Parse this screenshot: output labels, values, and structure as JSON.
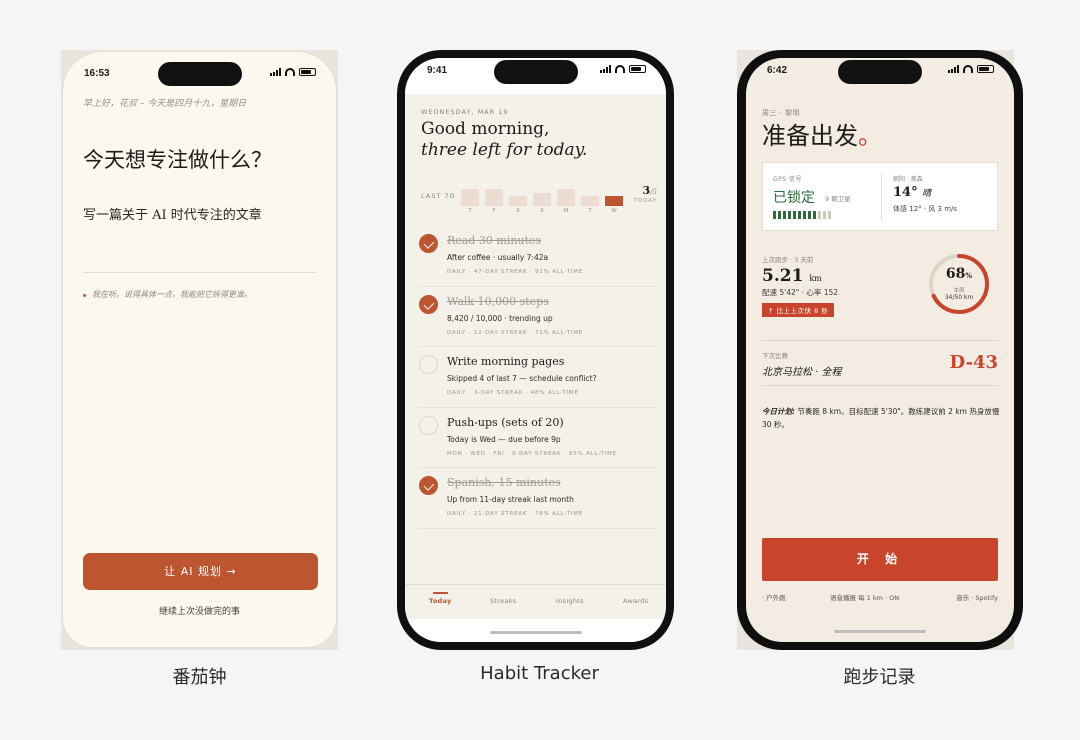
{
  "captions": [
    "番茄钟",
    "Habit Tracker",
    "跑步记录"
  ],
  "pomodoro": {
    "time": "16:53",
    "greeting": "早上好，花叔 – 今天是四月十九，星期日",
    "question": "今天想专注做什么？",
    "answer": "写一篇关于 AI 时代专注的文章",
    "hint": "我在听。说得具体一点，我能把它拆得更准。",
    "cta": "让 AI 规划 →",
    "secondary": "继续上次没做完的事",
    "accent": "#be5531"
  },
  "habits": {
    "time": "9:41",
    "date": "WEDNESDAY, MAR 19",
    "greeting": "Good morning,",
    "greeting2": "three left for today.",
    "week_label": "LAST 7D",
    "week": [
      {
        "day": "T",
        "level": 0.85
      },
      {
        "day": "F",
        "level": 0.85
      },
      {
        "day": "S",
        "level": 0.5
      },
      {
        "day": "S",
        "level": 0.65
      },
      {
        "day": "M",
        "level": 0.85
      },
      {
        "day": "T",
        "level": 0.5
      },
      {
        "day": "W",
        "level": 0.5,
        "current": true
      }
    ],
    "count": "3",
    "count_total": "/5",
    "today": "TODAY",
    "items": [
      {
        "name": "Read 30 minutes",
        "detail": "After coffee · usually 7:42a",
        "meta": "DAILY · 47-DAY STREAK · 92% ALL-TIME",
        "done": true
      },
      {
        "name": "Walk 10,000 steps",
        "detail": "8,420 / 10,000 · trending up",
        "meta": "DAILY · 12-DAY STREAK · 71% ALL-TIME",
        "done": true
      },
      {
        "name": "Write morning pages",
        "detail": "Skipped 4 of last 7 — schedule conflict?",
        "meta": "DAILY · 3-DAY STREAK · 48% ALL-TIME",
        "done": false
      },
      {
        "name": "Push-ups (sets of 20)",
        "detail": "Today is Wed — due before 9p",
        "meta": "MON · WED · FRI · 8-DAY STREAK · 85% ALL-TIME",
        "done": false
      },
      {
        "name": "Spanish, 15 minutes",
        "detail": "Up from 11-day streak last month",
        "meta": "DAILY · 21-DAY STREAK · 78% ALL-TIME",
        "done": true
      }
    ],
    "tabs": [
      "Today",
      "Streaks",
      "Insights",
      "Awards"
    ]
  },
  "running": {
    "time": "6:42",
    "weekday": "周三 · 黎明",
    "title": "准备出发",
    "title_dot": "。",
    "gps_label": "GPS 信号",
    "gps_status": "已锁定",
    "gps_sats": "9 颗卫星",
    "gps_strength": 0.75,
    "weather_label": "朝阳 · 奥森",
    "temp": "14°",
    "weather": "晴",
    "feel": "体感 12° · 风 3 m/s",
    "last_label": "上次跑步 · 3 天前",
    "last_dist": "5.21",
    "last_unit": "km",
    "last_pace": "配速 5'42\" · 心率 152",
    "last_badge": "↑ 比上上次快 8 秒",
    "ring_pct": "68",
    "ring_pct_unit": "%",
    "ring_progress": 0.68,
    "ring_label": "本周",
    "ring_value": "34/50 km",
    "race_label": "下次比赛",
    "race_name": "北京马拉松 · 全程",
    "race_countdown": "D-43",
    "plan_label": "今日计划:",
    "plan_text": "节奏跑 8 km。目标配速 5'30\"。教练建议前 2 km 热身放慢 30 秒。",
    "start": "开 始",
    "foot_a": "· 户外跑",
    "foot_b": "语音播报 每 1 km · ON",
    "foot_c": "音乐 · Spotify",
    "accent": "#c8442a"
  }
}
